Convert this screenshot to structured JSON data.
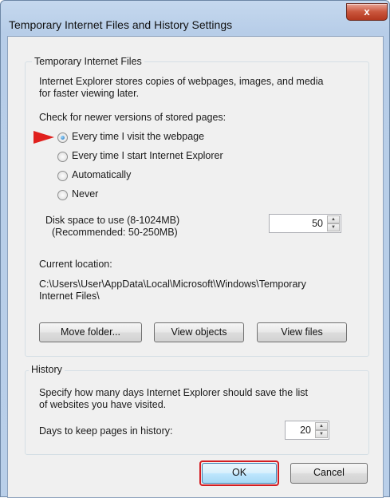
{
  "window": {
    "title": "Temporary Internet Files and History Settings",
    "close_glyph": "x"
  },
  "temp_files": {
    "legend": "Temporary Internet Files",
    "description_line1": "Internet Explorer stores copies of webpages, images, and media",
    "description_line2": "for faster viewing later.",
    "check_label": "Check for newer versions of stored pages:",
    "options": [
      {
        "label": "Every time I visit the webpage",
        "selected": true
      },
      {
        "label": "Every time I start Internet Explorer",
        "selected": false
      },
      {
        "label": "Automatically",
        "selected": false
      },
      {
        "label": "Never",
        "selected": false
      }
    ],
    "disk_label_line1": "Disk space to use (8-1024MB)",
    "disk_label_line2": "(Recommended: 50-250MB)",
    "disk_value": "50",
    "current_location_label": "Current location:",
    "location_line1": "C:\\Users\\User\\AppData\\Local\\Microsoft\\Windows\\Temporary",
    "location_line2": "Internet Files\\",
    "buttons": {
      "move_folder": "Move folder...",
      "view_objects": "View objects",
      "view_files": "View files"
    }
  },
  "history": {
    "legend": "History",
    "description_line1": "Specify how many days Internet Explorer should save the list",
    "description_line2": "of websites you have visited.",
    "days_label": "Days to keep pages in history:",
    "days_value": "20"
  },
  "footer": {
    "ok": "OK",
    "cancel": "Cancel"
  },
  "colors": {
    "annotation_red": "#e0201d",
    "close_button": "#c9553c",
    "dialog_background": "#f0f0f0"
  }
}
